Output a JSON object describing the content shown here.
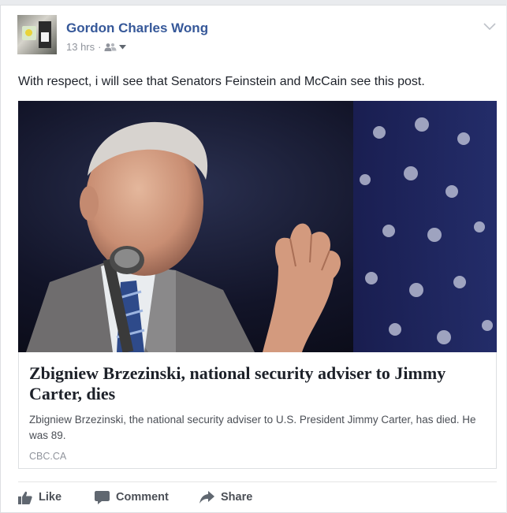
{
  "post": {
    "author": "Gordon Charles Wong",
    "time": "13 hrs",
    "separator": "·",
    "privacy_icon": "friends-icon",
    "text": "With respect, i will see that Senators Feinstein and McCain see this post."
  },
  "link": {
    "title": "Zbigniew Brzezinski, national security adviser to Jimmy Carter, dies",
    "description": "Zbigniew Brzezinski, the national security adviser to U.S. President Jimmy Carter, has died. He was 89.",
    "domain": "CBC.CA"
  },
  "actions": {
    "like": "Like",
    "comment": "Comment",
    "share": "Share"
  },
  "colors": {
    "author_link": "#365899",
    "text": "#1d2129",
    "secondary": "#90949c",
    "action_text": "#4b4f56"
  }
}
